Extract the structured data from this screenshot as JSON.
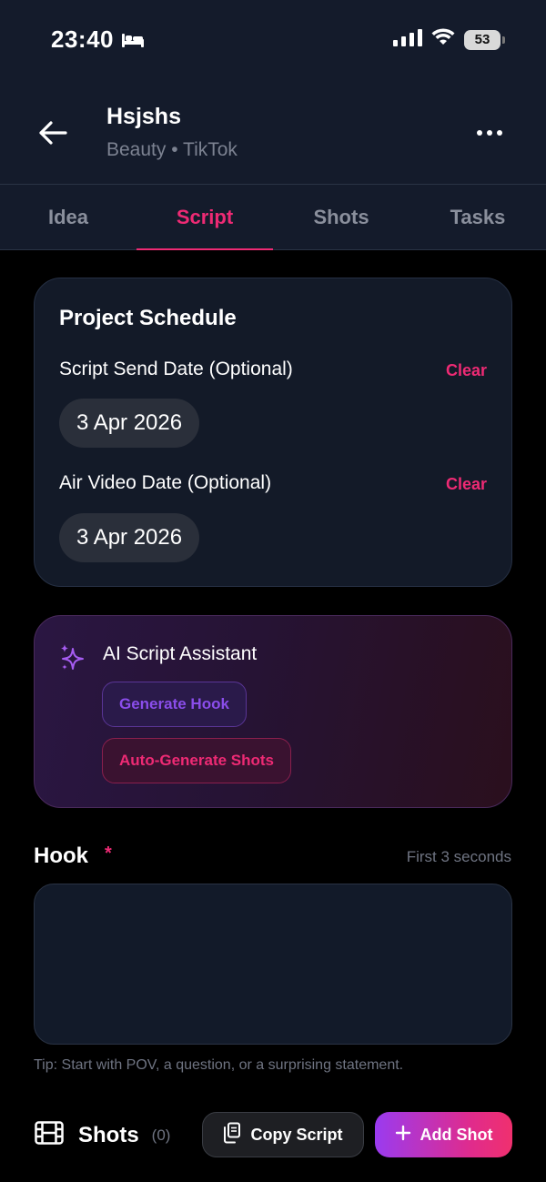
{
  "status_bar": {
    "time": "23:40",
    "battery": "53"
  },
  "header": {
    "title": "Hsjshs",
    "subtitle": "Beauty • TikTok"
  },
  "tabs": [
    {
      "label": "Idea"
    },
    {
      "label": "Script"
    },
    {
      "label": "Shots"
    },
    {
      "label": "Tasks"
    }
  ],
  "schedule": {
    "title": "Project Schedule",
    "script_send_label": "Script Send Date (Optional)",
    "script_send_value": "3 Apr 2026",
    "air_video_label": "Air Video Date (Optional)",
    "air_video_value": "3 Apr 2026",
    "clear_label": "Clear"
  },
  "ai_assistant": {
    "title": "AI Script Assistant",
    "generate_hook": "Generate Hook",
    "auto_generate_shots": "Auto-Generate Shots"
  },
  "hook": {
    "label": "Hook",
    "required_marker": "*",
    "hint": "First 3 seconds",
    "value": "",
    "tip": "Tip: Start with POV, a question, or a surprising statement."
  },
  "bottom_bar": {
    "shots_title": "Shots",
    "shots_count": "(0)",
    "copy_script": "Copy Script",
    "add_shot": "Add Shot"
  },
  "colors": {
    "accent": "#ee2a74",
    "purple": "#8a4dea",
    "background": "#000000",
    "surface": "#141b2b"
  }
}
